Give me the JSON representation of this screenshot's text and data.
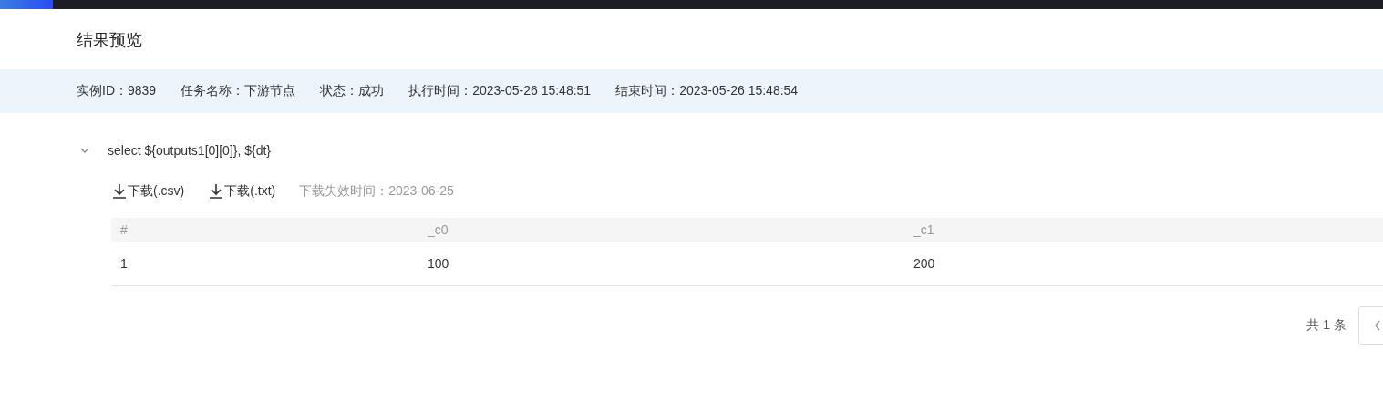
{
  "title": "结果预览",
  "info": [
    "实例ID：9839",
    "任务名称：下游节点",
    "状态：成功",
    "执行时间：2023-05-26 15:48:51",
    "结束时间：2023-05-26 15:48:54"
  ],
  "query": {
    "text": "select ${outputs1[0][0]}, ${dt}",
    "expanded": true
  },
  "downloads": [
    "下载(.csv)",
    "下载(.txt)"
  ],
  "expiry": "下载失效时间：2023-06-25",
  "table": {
    "columns": [
      "#",
      "_c0",
      "_c1"
    ],
    "rows": [
      [
        "1",
        "100",
        "200"
      ]
    ]
  },
  "pagination": {
    "total": "共 1 条"
  }
}
